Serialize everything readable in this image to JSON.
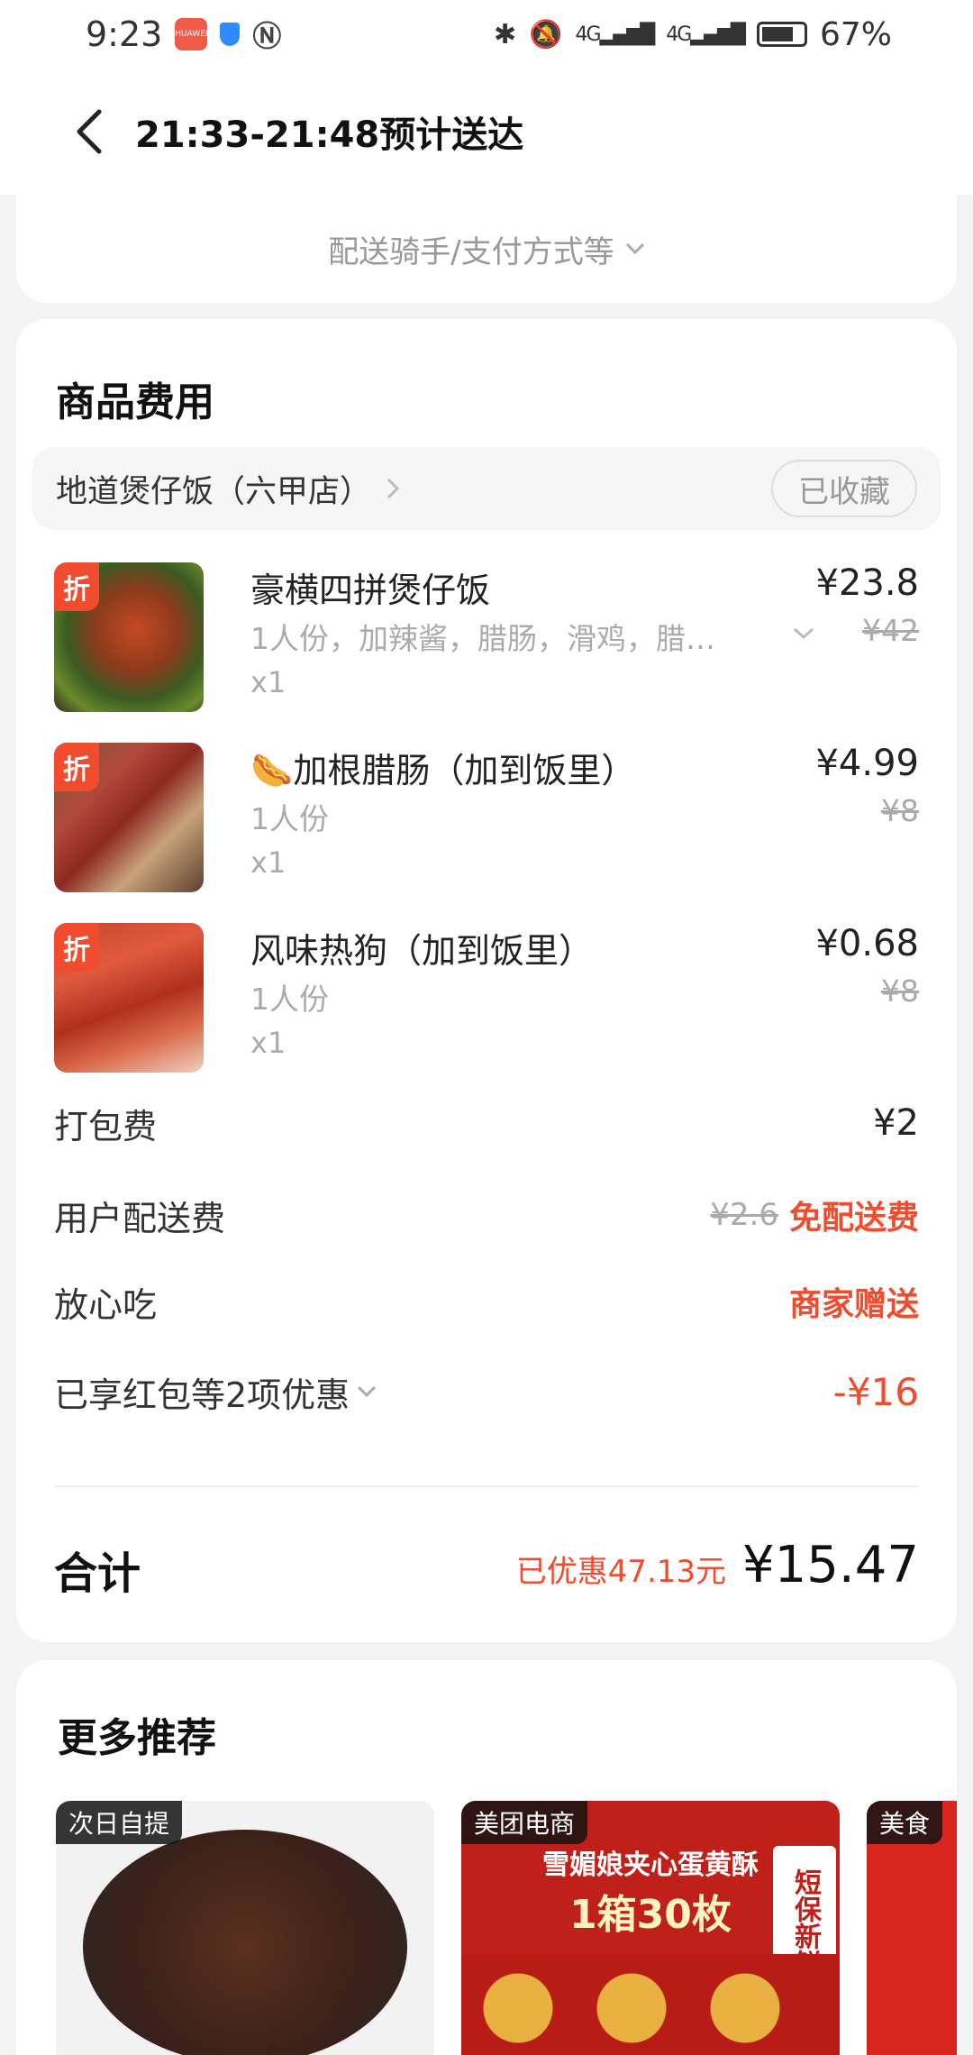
{
  "status_bar": {
    "time": "9:23",
    "app_badge": "HUAWEI",
    "network_1": "4G",
    "network_2": "4G",
    "battery": "67%"
  },
  "header": {
    "title": "21:33-21:48预计送达"
  },
  "top_card": {
    "expand_label": "配送骑手/支付方式等"
  },
  "fees_card": {
    "title": "商品费用",
    "store_name": "地道煲仔饭（六甲店）",
    "favorite_label": "已收藏",
    "badge_label": "折",
    "items": [
      {
        "name": "豪横四拼煲仔饭",
        "spec": "1人份，加辣酱，腊肠，滑鸡，腊…",
        "qty": "x1",
        "price": "¥23.8",
        "original_price": "¥42"
      },
      {
        "name": "🌭加根腊肠（加到饭里）",
        "spec": "1人份",
        "qty": "x1",
        "price": "¥4.99",
        "original_price": "¥8"
      },
      {
        "name": "风味热狗（加到饭里）",
        "spec": "1人份",
        "qty": "x1",
        "price": "¥0.68",
        "original_price": "¥8"
      }
    ],
    "packing_fee_label": "打包费",
    "packing_fee_value": "¥2",
    "delivery_fee_label": "用户配送费",
    "delivery_fee_original": "¥2.6",
    "delivery_fee_value": "免配送费",
    "assurance_label": "放心吃",
    "assurance_value": "商家赠送",
    "discount_label": "已享红包等2项优惠",
    "discount_value": "-¥16",
    "total_label": "合计",
    "saved_text": "已优惠47.13元",
    "total_value": "¥15.47"
  },
  "recommend": {
    "title": "更多推荐",
    "cards": [
      {
        "tag": "次日自提"
      },
      {
        "tag": "美团电商",
        "banner_line1": "雪媚娘夹心蛋黄酥",
        "banner_line2": "1箱30枚",
        "side_text": "短保新鲜"
      },
      {
        "tag": "美食"
      }
    ]
  },
  "colors": {
    "accent_red": "#f04c2d",
    "page_bg": "#f4f4f4"
  },
  "icons": {
    "back": "back-arrow-icon",
    "chevron": "chevron-down-icon",
    "store_chevron": "chevron-right-icon"
  }
}
